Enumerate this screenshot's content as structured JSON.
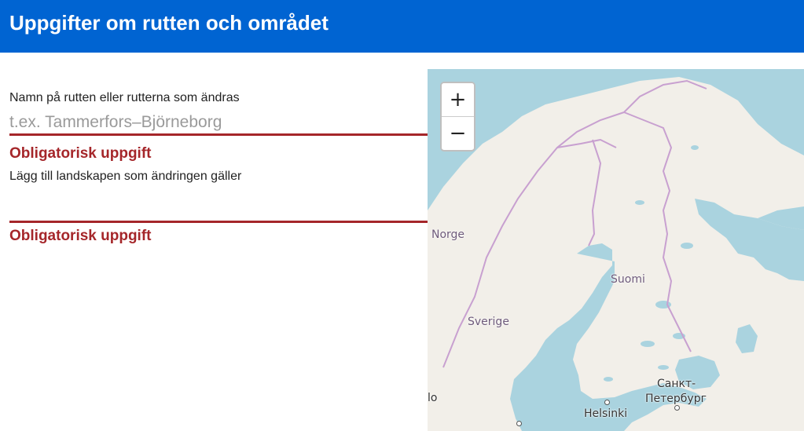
{
  "header": {
    "title": "Uppgifter om rutten och området"
  },
  "form": {
    "route_name": {
      "label": "Namn på rutten eller rutterna som ändras",
      "placeholder": "t.ex. Tammerfors–Björneborg",
      "value": "",
      "error": "Obligatorisk uppgift"
    },
    "regions": {
      "label": "Lägg till landskapen som ändringen gäller",
      "value": "",
      "error": "Obligatorisk uppgift"
    }
  },
  "map": {
    "zoom_in_label": "+",
    "zoom_out_label": "−",
    "labels": {
      "norway": "Norge",
      "finland": "Suomi",
      "sweden": "Sverige",
      "oslo_partial": "lo",
      "helsinki": "Helsinki",
      "st_petersburg_line1": "Санкт-",
      "st_petersburg_line2": "Петербург"
    },
    "colors": {
      "water": "#aad3df",
      "land": "#f2efe9",
      "border": "#c8a0d0"
    }
  }
}
